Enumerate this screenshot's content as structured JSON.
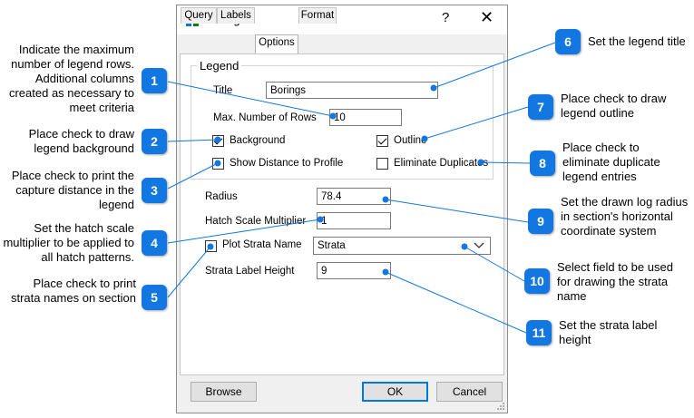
{
  "window": {
    "title": "Borings",
    "help_glyph": "?",
    "close_glyph": "✕"
  },
  "tabs": [
    {
      "label": "Query"
    },
    {
      "label": "Labels"
    },
    {
      "label": "Options",
      "active": true
    },
    {
      "label": "Format"
    }
  ],
  "legend_group": {
    "label": "Legend",
    "title_label": "Title",
    "title_value": "Borings",
    "max_rows_label": "Max. Number of Rows",
    "max_rows_value": "10",
    "background_label": "Background",
    "background_checked": true,
    "outline_label": "Outline",
    "outline_checked": true,
    "show_distance_label": "Show Distance to Profile",
    "show_distance_checked": false,
    "eliminate_duplicates_label": "Eliminate Duplicates",
    "eliminate_duplicates_checked": false
  },
  "options": {
    "radius_label": "Radius",
    "radius_value": "78.4",
    "hatch_label": "Hatch Scale Multiplier",
    "hatch_value": "1",
    "plot_strata_label": "Plot Strata Name",
    "plot_strata_checked": false,
    "strata_field_value": "Strata",
    "strata_height_label": "Strata Label Height",
    "strata_height_value": "9"
  },
  "buttons": {
    "browse": "Browse",
    "ok": "OK",
    "cancel": "Cancel"
  },
  "callouts": [
    {
      "number": "1",
      "text": "Indicate the maximum number of legend rows. Additional columns created as necessary to meet criteria"
    },
    {
      "number": "2",
      "text": "Place check to draw legend background"
    },
    {
      "number": "3",
      "text": "Place check to print the capture distance in the legend"
    },
    {
      "number": "4",
      "text": "Set the hatch scale multiplier to be applied to all hatch patterns."
    },
    {
      "number": "5",
      "text": "Place check to print strata names on section"
    },
    {
      "number": "6",
      "text": "Set the legend title"
    },
    {
      "number": "7",
      "text": "Place check to draw legend outline"
    },
    {
      "number": "8",
      "text": "Place check to eliminate duplicate legend entries"
    },
    {
      "number": "9",
      "text": "Set the drawn log radius in section's horizontal coordinate system"
    },
    {
      "number": "10",
      "text": "Select field to be used for drawing the strata name"
    },
    {
      "number": "11",
      "text": "Set the strata label height"
    }
  ],
  "colors": {
    "badge": "#1277e0",
    "accent": "#0078d7",
    "dialog_bg": "#f0f0f0"
  },
  "icons": {
    "app": "borings-app-icon",
    "combo": "chevron-down-icon",
    "grip": "resize-grip-icon"
  }
}
